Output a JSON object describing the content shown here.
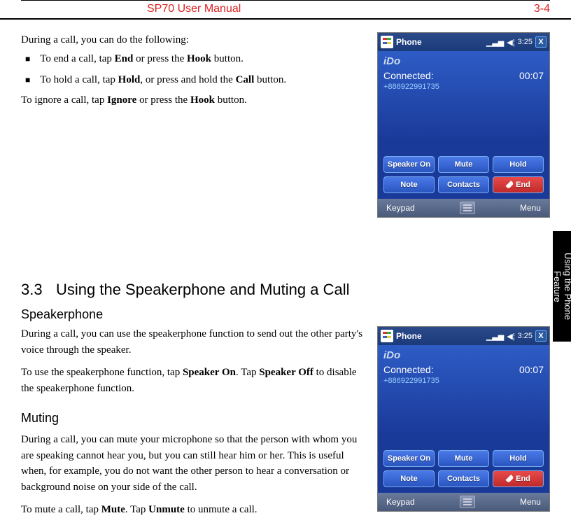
{
  "header": {
    "title": "SP70 User Manual",
    "page": "3-4"
  },
  "side_tab": "Using the Phone Feature",
  "intro": {
    "lead": "During a call, you can do the following:",
    "bullets": [
      {
        "t1": "To end a call, tap ",
        "b1": "End",
        "t2": " or press the ",
        "b2": "Hook",
        "t3": " button."
      },
      {
        "t1": "To hold a call, tap ",
        "b1": "Hold",
        "t2": ", or press and hold the ",
        "b2": "Call",
        "t3": " button."
      }
    ],
    "ignore": {
      "t1": "To ignore a call, tap ",
      "b1": "Ignore",
      "t2": " or press the ",
      "b2": "Hook",
      "t3": " button."
    }
  },
  "section": {
    "num": "3.3",
    "title": "Using the Speakerphone and Muting a Call"
  },
  "speakerphone": {
    "heading": "Speakerphone",
    "p1": "During a call, you can use the speakerphone function to send out the other party's voice through the speaker.",
    "p2a": "To use the speakerphone function, tap ",
    "p2b1": "Speaker On",
    "p2c": ". Tap ",
    "p2b2": "Speaker Off",
    "p2d": " to disable the speakerphone function."
  },
  "muting": {
    "heading": "Muting",
    "p1": "During a call, you can mute your microphone so that the person with whom you are speaking cannot hear you, but you can still hear him or her. This is useful when, for example, you do not want the other person to hear a conversation or background noise on your side of the call.",
    "p2a": "To mute a call, tap ",
    "p2b1": "Mute",
    "p2c": ". Tap ",
    "p2b2": "Unmute",
    "p2d": " to unmute a call."
  },
  "phone": {
    "title": "Phone",
    "time": "3:25",
    "logo": "iDo",
    "status": "Connected:",
    "timer": "00:07",
    "number": "+886922991735",
    "buttons": {
      "speaker": "Speaker On",
      "mute": "Mute",
      "hold": "Hold",
      "note": "Note",
      "contacts": "Contacts",
      "end": "End"
    },
    "bottombar": {
      "left": "Keypad",
      "right": "Menu"
    },
    "close": "X"
  }
}
